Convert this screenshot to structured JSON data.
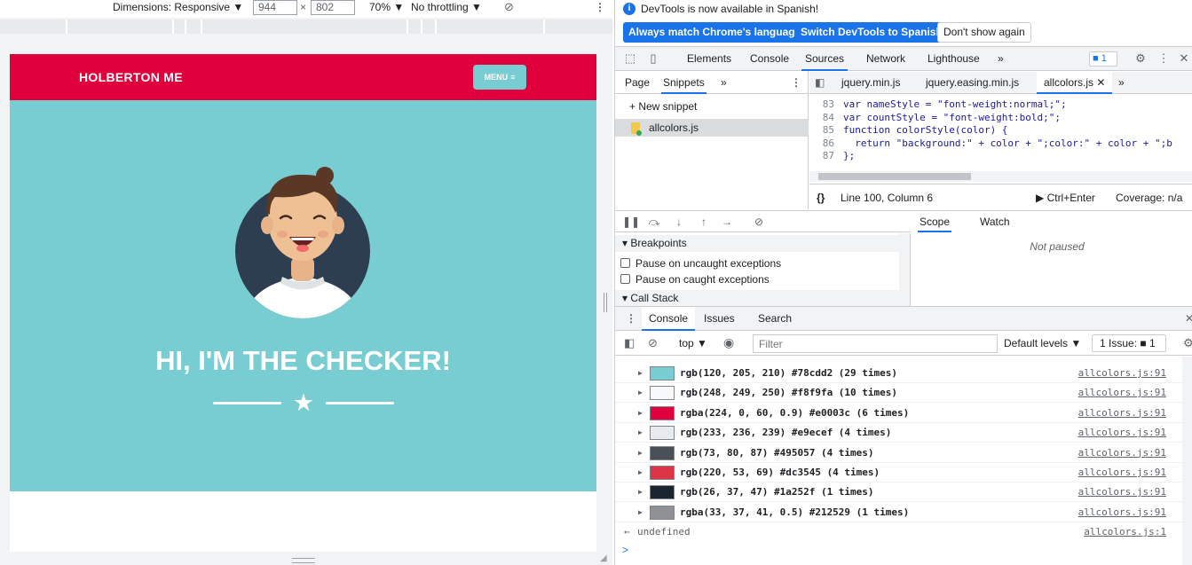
{
  "device_toolbar": {
    "dimensions": "Dimensions: Responsive ▼",
    "width": "944",
    "height": "802",
    "times": "×",
    "zoom": "70% ▼",
    "throttling": "No throttling ▼"
  },
  "site": {
    "brand": "HOLBERTON ME",
    "menu_label": "MENU",
    "hero_title": "HI, I'M THE CHECKER!",
    "colors": {
      "nav": "#e0003c",
      "masthead": "#78cdd2"
    }
  },
  "infobar": {
    "message": "DevTools is now available in Spanish!",
    "btn_match": "Always match Chrome's language",
    "btn_switch": "Switch DevTools to Spanish",
    "btn_dismiss": "Don't show again"
  },
  "main_tabs": {
    "elements": "Elements",
    "console": "Console",
    "sources": "Sources",
    "network": "Network",
    "lighthouse": "Lighthouse",
    "more": "»",
    "issues_badge": "1"
  },
  "navigator": {
    "tab_page": "Page",
    "tab_snippets": "Snippets",
    "more": "»",
    "new_snippet": "+ New snippet",
    "snippet": "allcolors.js"
  },
  "editor": {
    "tabs": [
      "jquery.min.js",
      "jquery.easing.min.js",
      "allcolors.js"
    ],
    "more": "»",
    "lines": [
      {
        "n": "83",
        "code": "var nameStyle = \"font-weight:normal;\";"
      },
      {
        "n": "84",
        "code": "var countStyle = \"font-weight:bold;\";"
      },
      {
        "n": "85",
        "code": "function colorStyle(color) {"
      },
      {
        "n": "86",
        "code": "  return \"background:\" + color + \";color:\" + color + \";b"
      },
      {
        "n": "87",
        "code": "};"
      }
    ],
    "status_braces": "{}",
    "status_position": "Line 100, Column 6",
    "status_run": "▶ Ctrl+Enter",
    "status_coverage": "Coverage: n/a"
  },
  "debugger": {
    "breakpoints": "Breakpoints",
    "pause_uncaught": "Pause on uncaught exceptions",
    "pause_caught": "Pause on caught exceptions",
    "call_stack": "Call Stack",
    "tab_scope": "Scope",
    "tab_watch": "Watch",
    "not_paused": "Not paused"
  },
  "drawer": {
    "tab_console": "Console",
    "tab_issues": "Issues",
    "tab_search": "Search",
    "context": "top ▼",
    "filter_placeholder": "Filter",
    "levels": "Default levels ▼",
    "issues": "1 Issue: ■ 1"
  },
  "console_messages": [
    {
      "text": "rgb(120, 205, 210) #78cdd2 (29 times)",
      "color": "#78cdd2",
      "src": "allcolors.js:91"
    },
    {
      "text": "rgb(248, 249, 250) #f8f9fa (10 times)",
      "color": "#f8f9fa",
      "src": "allcolors.js:91"
    },
    {
      "text": "rgba(224, 0, 60, 0.9) #e0003c (6 times)",
      "color": "#e0003c",
      "src": "allcolors.js:91"
    },
    {
      "text": "rgb(233, 236, 239) #e9ecef (4 times)",
      "color": "#e9ecef",
      "src": "allcolors.js:91"
    },
    {
      "text": "rgb(73, 80, 87) #495057 (4 times)",
      "color": "#495057",
      "src": "allcolors.js:91"
    },
    {
      "text": "rgb(220, 53, 69) #dc3545 (4 times)",
      "color": "#dc3545",
      "src": "allcolors.js:91"
    },
    {
      "text": "rgb(26, 37, 47) #1a252f (1 times)",
      "color": "#1a252f",
      "src": "allcolors.js:91"
    },
    {
      "text": "rgba(33, 37, 41, 0.5) #212529 (1 times)",
      "color": "#8f9194",
      "src": "allcolors.js:91"
    }
  ],
  "console_result": {
    "arrow": "←",
    "value": "undefined",
    "src": "allcolors.js:1",
    "prompt": ">"
  }
}
